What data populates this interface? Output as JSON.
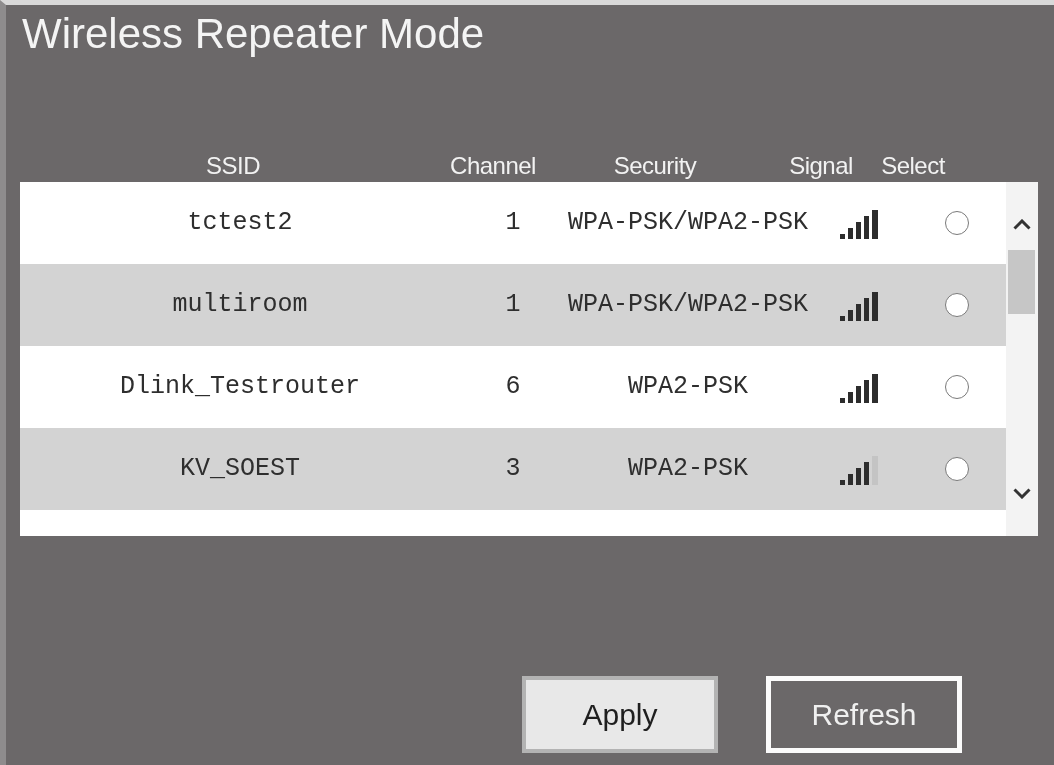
{
  "title": "Wireless Repeater Mode",
  "table": {
    "columns": [
      "SSID",
      "Channel",
      "Security",
      "Signal",
      "Select"
    ],
    "rows": [
      {
        "ssid": "tctest2",
        "channel": "1",
        "security": "WPA-PSK/WPA2-PSK",
        "signal_full": true,
        "selected": false
      },
      {
        "ssid": "multiroom",
        "channel": "1",
        "security": "WPA-PSK/WPA2-PSK",
        "signal_full": true,
        "selected": false
      },
      {
        "ssid": "Dlink_Testrouter",
        "channel": "6",
        "security": "WPA2-PSK",
        "signal_full": true,
        "selected": false
      },
      {
        "ssid": "KV_SOEST",
        "channel": "3",
        "security": "WPA2-PSK",
        "signal_full": false,
        "selected": false
      }
    ]
  },
  "buttons": [
    {
      "label": "Apply",
      "kind": "filled"
    },
    {
      "label": "Refresh",
      "kind": "outlined"
    }
  ]
}
